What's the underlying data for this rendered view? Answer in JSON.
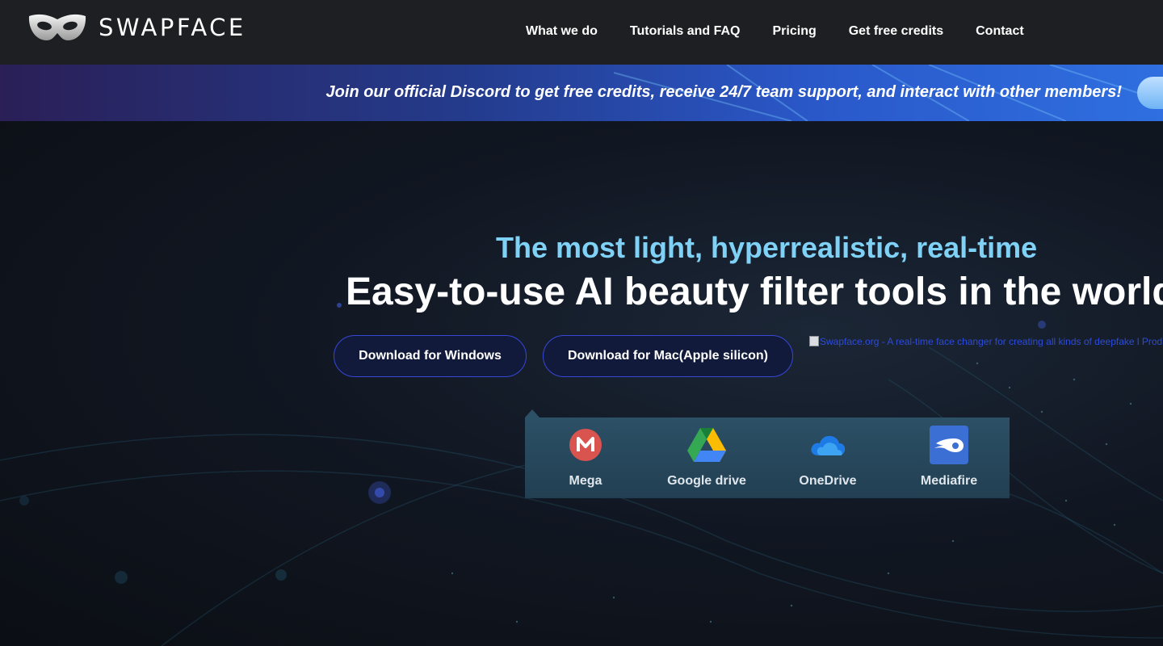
{
  "brand": {
    "name": "SWAPFACE"
  },
  "nav": {
    "items": [
      {
        "label": "What we do"
      },
      {
        "label": "Tutorials and FAQ"
      },
      {
        "label": "Pricing"
      },
      {
        "label": "Get free credits"
      },
      {
        "label": "Contact"
      }
    ]
  },
  "banner": {
    "text": "Join our official Discord to get free credits, receive 24/7 team support, and interact with other members!"
  },
  "hero": {
    "subtitle": "The most light, hyperrealistic, real-time",
    "title": "Easy-to-use AI beauty filter tools in the world",
    "download_windows": "Download for Windows",
    "download_mac": "Download for Mac(Apple silicon)",
    "image_alt": "Swapface.org - A real-time face changer for creating all kinds of deepfake l Product Hunt"
  },
  "mirrors": [
    {
      "label": "Mega",
      "icon": "mega-icon"
    },
    {
      "label": "Google drive",
      "icon": "google-drive-icon"
    },
    {
      "label": "OneDrive",
      "icon": "onedrive-icon"
    },
    {
      "label": "Mediafire",
      "icon": "mediafire-icon"
    }
  ],
  "colors": {
    "nav_bg": "#1d1f22",
    "subtitle": "#7fd1f5",
    "button_border": "#3747d6",
    "mega_red": "#d9534f",
    "mediafire_blue": "#3b6fd4"
  }
}
